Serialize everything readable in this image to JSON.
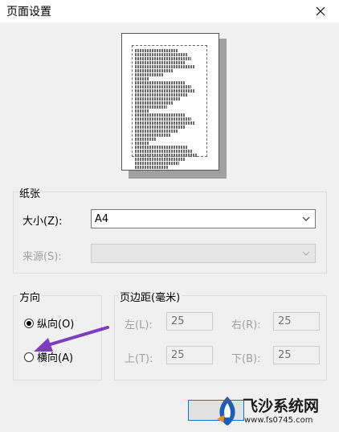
{
  "window": {
    "title": "页面设置"
  },
  "paper_group": {
    "label": "纸张",
    "size_label": "大小(Z):",
    "size_value": "A4",
    "source_label": "来源(S):",
    "source_value": ""
  },
  "orientation_group": {
    "label": "方向",
    "portrait_label": "纵向(O)",
    "landscape_label": "横向(A)",
    "selected": "portrait"
  },
  "margins_group": {
    "label": "页边距(毫米)",
    "left_label": "左(L):",
    "left_value": "25",
    "right_label": "右(R):",
    "right_value": "25",
    "top_label": "上(T):",
    "top_value": "25",
    "bottom_label": "下(B):",
    "bottom_value": "25"
  },
  "watermark": {
    "text": "飞沙系统网",
    "url": "www.fs0745.com"
  },
  "colors": {
    "accent": "#0078d7",
    "arrow": "#7b3ec0"
  }
}
